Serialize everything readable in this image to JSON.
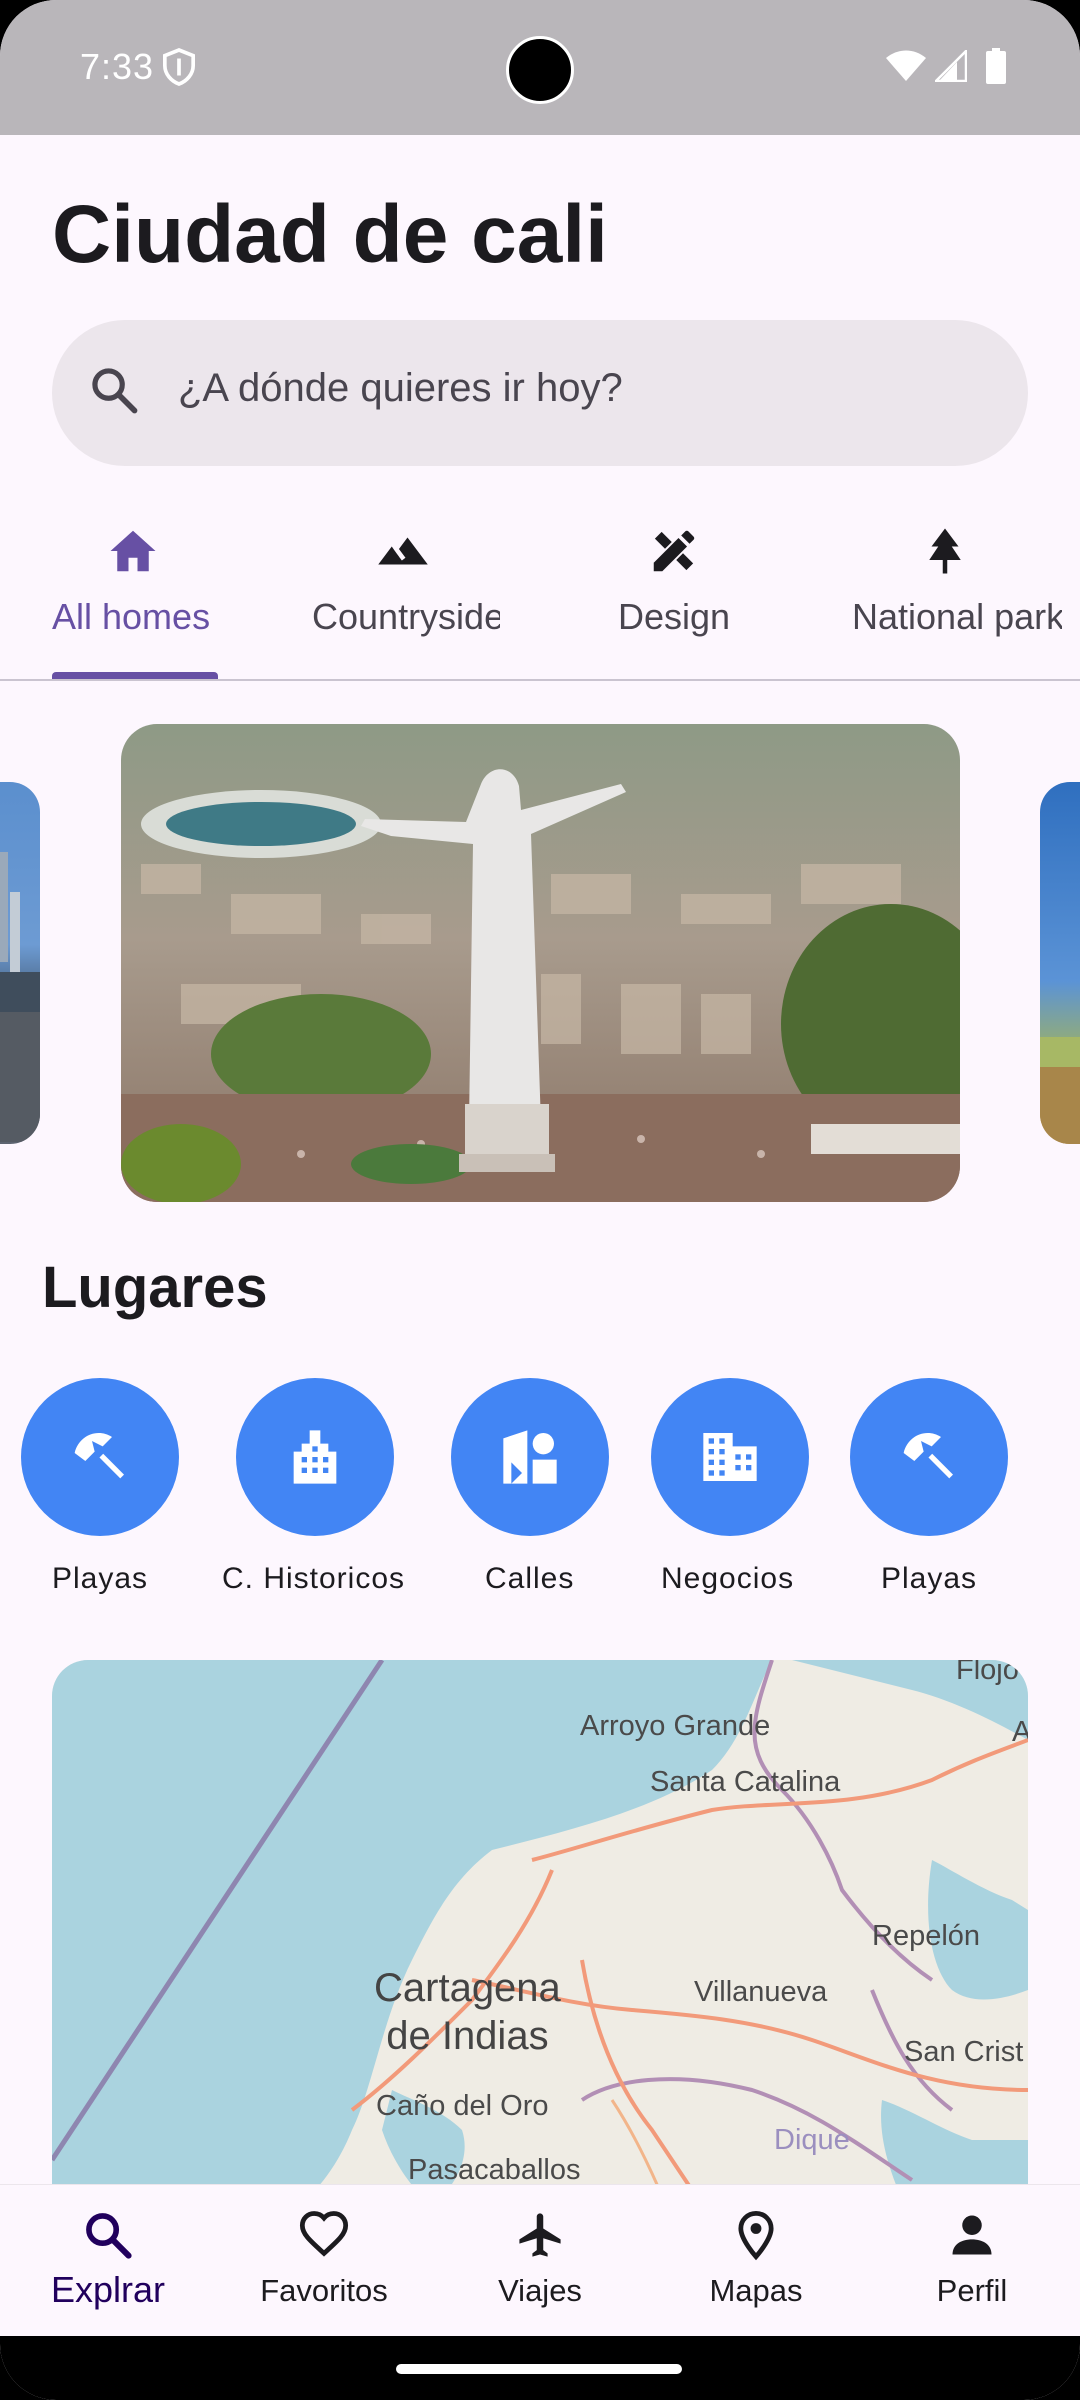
{
  "status_bar": {
    "time": "7:33"
  },
  "page": {
    "title": "Ciudad de cali"
  },
  "search": {
    "placeholder": "¿A dónde quieres ir hoy?"
  },
  "tabs": [
    {
      "label": "All homes",
      "icon": "home-icon",
      "active": true
    },
    {
      "label": "Countryside",
      "icon": "landscape-icon",
      "active": false
    },
    {
      "label": "Design",
      "icon": "design-tools-icon",
      "active": false
    },
    {
      "label": "National parks",
      "icon": "tree-icon",
      "active": false
    }
  ],
  "carousel": {
    "hero_description": "Cristo Rey statue overlooking Cali"
  },
  "places": {
    "title": "Lugares",
    "items": [
      {
        "label": "Playas",
        "icon": "beach-umbrella-icon"
      },
      {
        "label": "C. Historicos",
        "icon": "historic-building-icon"
      },
      {
        "label": "Calles",
        "icon": "streets-icon"
      },
      {
        "label": "Negocios",
        "icon": "business-building-icon"
      },
      {
        "label": "Playas",
        "icon": "beach-umbrella-icon"
      }
    ],
    "accent_color": "#4285f4"
  },
  "map": {
    "labels": {
      "flojo": "Flojo",
      "arroyo_grande": "Arroyo Grande",
      "santa_catalina": "Santa Catalina",
      "repelon": "Repelón",
      "villanueva": "Villanueva",
      "cartagena_1": "Cartagena",
      "cartagena_2": "de Indias",
      "cano_del_oro": "Caño del Oro",
      "san_cristobal": "San Crist",
      "dique": "Dique",
      "pasacaballos": "Pasacaballos",
      "edge_a": "A"
    }
  },
  "bottom_nav": [
    {
      "label": "Explrar",
      "icon": "search-icon",
      "active": true
    },
    {
      "label": "Favoritos",
      "icon": "heart-icon",
      "active": false
    },
    {
      "label": "Viajes",
      "icon": "airplane-icon",
      "active": false
    },
    {
      "label": "Mapas",
      "icon": "location-pin-icon",
      "active": false
    },
    {
      "label": "Perfil",
      "icon": "person-icon",
      "active": false
    }
  ],
  "colors": {
    "primary": "#6750a4",
    "background": "#fdf7fe",
    "surface_variant": "#ece6ec"
  }
}
